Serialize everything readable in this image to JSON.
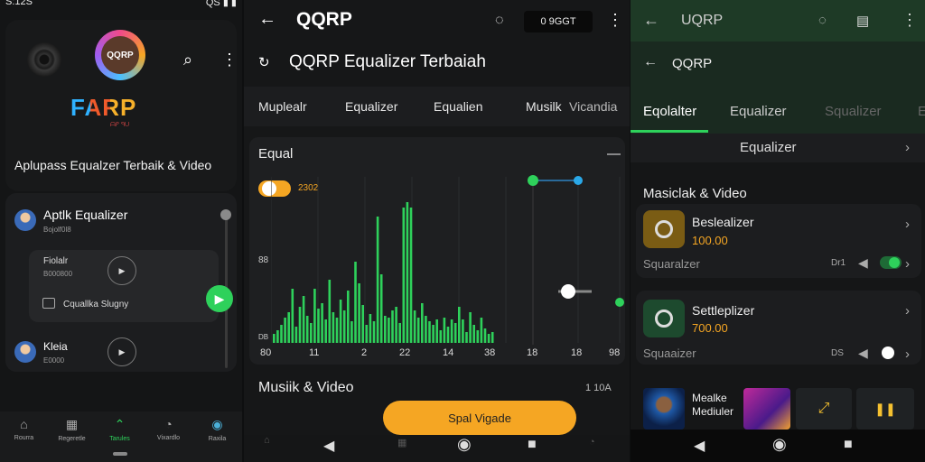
{
  "panel1": {
    "status_left": "S:12S",
    "status_right": "QS ▮ ▮",
    "logo_text": "QQRP",
    "brand": "FARP",
    "brand_sub": "ᗩᑭ ᑫᑌ",
    "tagline": "Aplupass Equalzer Terbaik & Video",
    "items": [
      {
        "title": "Aptlk Equalizer",
        "subtitle": "Bojolf0l8"
      },
      {
        "title": "Fiolalr",
        "subtitle": "B000800"
      },
      {
        "title": "Cquallka Slugny"
      },
      {
        "title": "Kleia",
        "subtitle": "E0000"
      }
    ],
    "bottom_nav": [
      {
        "label": "Rourra",
        "icon": "home-icon"
      },
      {
        "label": "Regeretle",
        "icon": "chart-icon"
      },
      {
        "label": "Tarules",
        "icon": "equalizer-icon"
      },
      {
        "label": "Vixardlo",
        "icon": "video-icon"
      },
      {
        "label": "Raxila",
        "icon": "profile-icon"
      }
    ],
    "accent": "#2ed15b"
  },
  "panel2": {
    "title": "QQRP",
    "status_pill": "0 9GGT",
    "subtitle": "QQRP Equalizer Terbaiah",
    "tabs": [
      "Muplealr",
      "Equalizer",
      "Equalien",
      "Musilk",
      "Vicandia"
    ],
    "eq_title": "Equal",
    "eq_toggle_value": "2302",
    "y_label_top": "88",
    "y_label_bottom": "DB",
    "x_labels": [
      "80",
      "11",
      "2",
      "22",
      "14",
      "38",
      "18",
      "18",
      "98"
    ],
    "section": "Musiik & Video",
    "section_right": "1 10A",
    "cta": "Spal Vigade",
    "accent": "#f5a623",
    "chart_color": "#2ed15b"
  },
  "panel3": {
    "title": "UQRP",
    "subtitle": "QQRP",
    "tabs": [
      "Eqolalter",
      "Equalizer",
      "Squalizer",
      "E"
    ],
    "eq_row": "Equalizer",
    "section": "Masiclak & Video",
    "cards": [
      {
        "name": "Beslealizer",
        "price": "100.00",
        "label": "Squaralzer",
        "side": "Dr1",
        "toggle_on": true
      },
      {
        "name": "Settleplizer",
        "price": "700.00",
        "label": "Squaaizer",
        "side": "DS",
        "toggle_on": false
      }
    ],
    "thumb_caption": "Mealke Mediuler"
  }
}
